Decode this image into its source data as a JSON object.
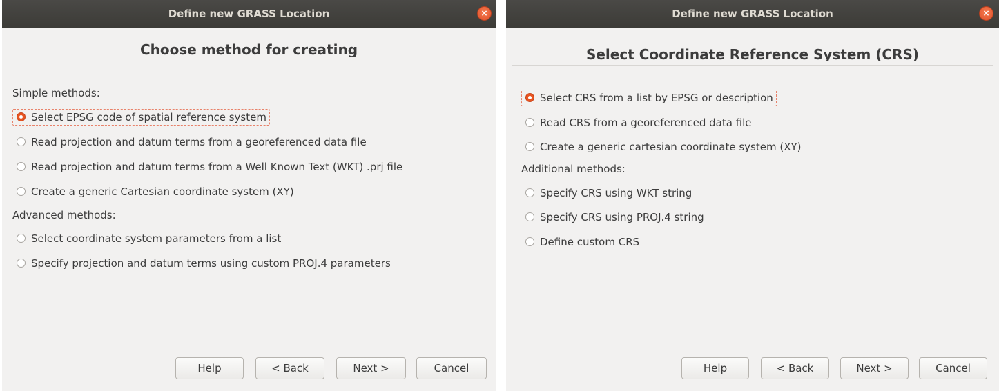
{
  "left_dialog": {
    "window_title": "Define new GRASS Location",
    "close_glyph": "×",
    "page_title": "Choose method for creating",
    "simple_label": "Simple methods:",
    "simple_options": [
      {
        "label": "Select EPSG code of spatial reference system",
        "selected": true
      },
      {
        "label": "Read projection and datum terms from a georeferenced data file",
        "selected": false
      },
      {
        "label": "Read projection and datum terms from a Well Known Text (WKT) .prj file",
        "selected": false
      },
      {
        "label": "Create a generic Cartesian coordinate system (XY)",
        "selected": false
      }
    ],
    "advanced_label": "Advanced methods:",
    "advanced_options": [
      {
        "label": "Select coordinate system parameters from a list",
        "selected": false
      },
      {
        "label": "Specify projection and datum terms using custom PROJ.4 parameters",
        "selected": false
      }
    ],
    "buttons": {
      "help": "Help",
      "back": "< Back",
      "next": "Next >",
      "cancel": "Cancel"
    }
  },
  "right_dialog": {
    "window_title": "Define new GRASS Location",
    "close_glyph": "×",
    "page_title": "Select Coordinate Reference System (CRS)",
    "options": [
      {
        "label": "Select CRS from a list by EPSG or description",
        "selected": true
      },
      {
        "label": "Read CRS from a georeferenced data file",
        "selected": false
      },
      {
        "label": "Create a generic cartesian coordinate system (XY)",
        "selected": false
      }
    ],
    "additional_label": "Additional methods:",
    "additional_options": [
      {
        "label": "Specify CRS using WKT string",
        "selected": false
      },
      {
        "label": "Specify CRS using PROJ.4 string",
        "selected": false
      },
      {
        "label": "Define custom CRS",
        "selected": false
      }
    ],
    "buttons": {
      "help": "Help",
      "back": "< Back",
      "next": "Next >",
      "cancel": "Cancel"
    }
  },
  "colors": {
    "accent": "#e95420",
    "titlebar": "#3c3b37",
    "dialog_bg": "#f2f1f0",
    "focus_outline": "#e8826a"
  },
  "icons": {
    "close": "close-icon",
    "radio_selected": "radio-selected-icon",
    "radio_unselected": "radio-unselected-icon"
  }
}
